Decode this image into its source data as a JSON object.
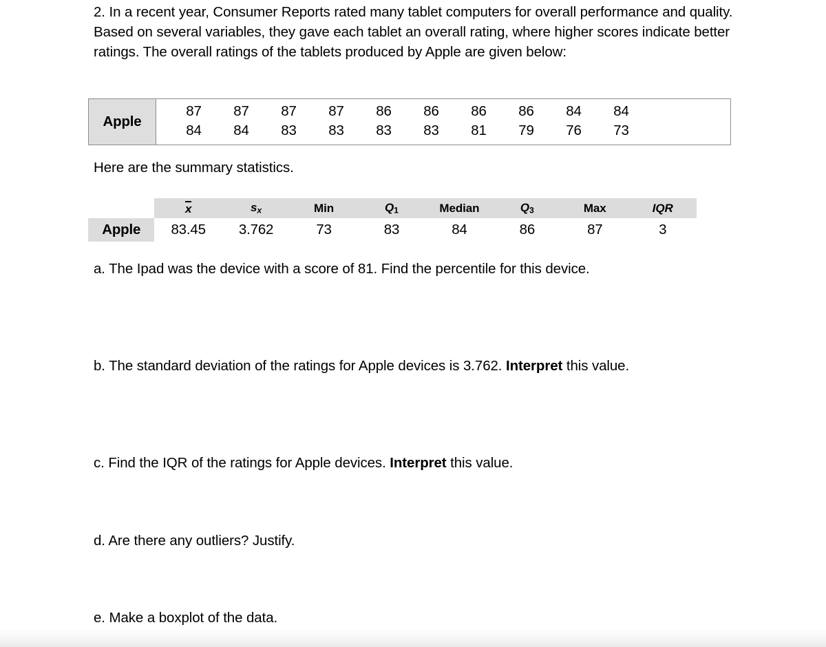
{
  "document": {
    "question_number": "2.",
    "intro_text": "2.  In a recent year, Consumer Reports rated many tablet computers for overall performance and quality. Based on several variables, they gave each tablet an overall rating, where higher scores indicate better ratings. The overall ratings of the tablets produced by Apple are given below:",
    "summary_lead": "Here are the summary statistics."
  },
  "data_table": {
    "row_label": "Apple",
    "row1": [
      "87",
      "87",
      "87",
      "87",
      "86",
      "86",
      "86",
      "86",
      "84",
      "84"
    ],
    "row2": [
      "84",
      "84",
      "83",
      "83",
      "83",
      "83",
      "81",
      "79",
      "76",
      "73"
    ]
  },
  "stats_table": {
    "row_label": "Apple",
    "headers": [
      "x̄",
      "sx",
      "Min",
      "Q1",
      "Median",
      "Q3",
      "Max",
      "IQR"
    ],
    "header_min": "Min",
    "header_median": "Median",
    "header_max": "Max",
    "header_iqr": "IQR",
    "header_q": "Q",
    "header_q1_sub": "1",
    "header_q3_sub": "3",
    "header_s": "s",
    "header_s_sub": "x",
    "header_xbar": "x",
    "values": {
      "mean": "83.45",
      "sx": "3.762",
      "min": "73",
      "q1": "83",
      "median": "84",
      "q3": "86",
      "max": "87",
      "iqr": "3"
    }
  },
  "questions": {
    "a": "a. The Ipad was the device with a score of 81.  Find the percentile for this device.",
    "b_before": "b. The standard deviation of the ratings for Apple devices is 3.762.  ",
    "b_bold": "Interpret",
    "b_after": " this value.",
    "c_before": "c. Find the IQR of the ratings for Apple devices.  ",
    "c_bold": "Interpret",
    "c_after": " this value.",
    "d": "d. Are there any outliers? Justify.",
    "e": "e. Make a boxplot of the data."
  },
  "colors": {
    "page_background": "#ffffff",
    "text": "#000000",
    "table_border": "#8c8c8c",
    "label_cell_fill": "#dedede",
    "stats_header_fill": "#dcdcdc"
  }
}
